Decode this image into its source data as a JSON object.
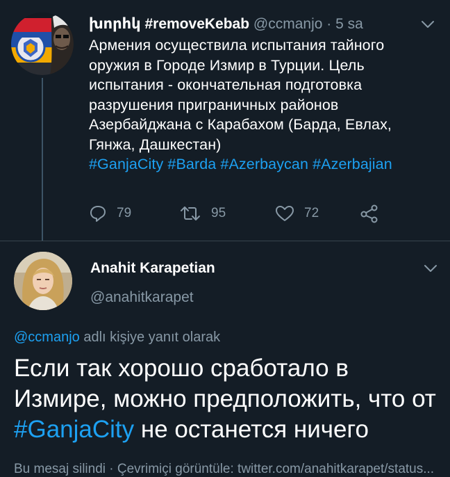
{
  "tweet": {
    "author_name": "խորհկ #removeKebab",
    "handle": "@ccmanjo",
    "separator": "·",
    "time": "5 sa",
    "text_lines": [
      "Армения осуществила испытания тайного",
      "оружия в Городе Измир в Турции. Цель",
      "испытания - окончательная подготовка",
      "разрушения приграничных районов",
      "Азербайджана с Карабахом (Барда, Евлах,",
      "Гянжа, Дашкестан)"
    ],
    "hashtags": "#GanjaCity #Barda #Azerbaycan #Azerbajian",
    "replies": "79",
    "retweets": "95",
    "likes": "72",
    "icons": {
      "reply": "reply-icon",
      "retweet": "retweet-icon",
      "like": "heart-icon",
      "share": "share-icon",
      "menu": "chevron-down-icon"
    }
  },
  "reply": {
    "author_name": "Anahit Karapetian",
    "handle": "@anahitkarapet",
    "replying_to_handle": "@ccmanjo",
    "replying_to_suffix": " adlı kişiye yanıt olarak",
    "text_part1": "Если так хорошо сработало в Измире, можно предположить, что от ",
    "text_hashtag": "#GanjaCity",
    "text_part2": " не останется ничего",
    "footer_text": "Bu mesaj silindi · Çevrimiçi görüntüle: twitter.com/anahitkarapet/status..."
  },
  "colors": {
    "background": "#141d26",
    "text": "#ffffff",
    "muted": "#8899a6",
    "link": "#1da1f2",
    "divider": "#38444d"
  }
}
